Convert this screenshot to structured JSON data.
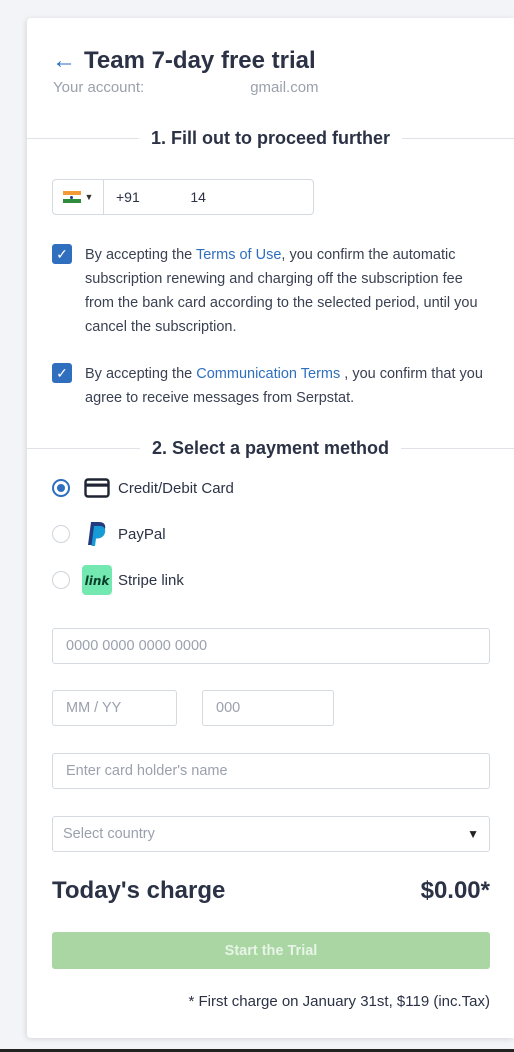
{
  "header": {
    "back_icon": "arrow-left-icon",
    "title": "Team 7-day free trial",
    "account_prefix": "Your account:",
    "account_suffix": "gmail.com"
  },
  "section1": {
    "title": "1. Fill out to proceed further"
  },
  "phone": {
    "country_flag": "india-flag-icon",
    "value": "+91             14"
  },
  "terms": {
    "before": "By accepting the ",
    "link": "Terms of Use",
    "after": ", you confirm the automatic subscription renewing and charging off the subscription fee from the bank card according to the selected period, until you cancel the subscription.",
    "checked": true
  },
  "communication": {
    "before": "By accepting the ",
    "link": "Communication Terms",
    "after": " , you confirm that you agree to receive messages from Serpstat.",
    "checked": true
  },
  "section2": {
    "title": "2. Select a payment method"
  },
  "payment_methods": [
    {
      "label": "Credit/Debit Card",
      "icon": "credit-card-icon",
      "selected": true
    },
    {
      "label": "PayPal",
      "icon": "paypal-icon",
      "selected": false
    },
    {
      "label": "Stripe link",
      "icon": "stripe-link-icon",
      "selected": false
    }
  ],
  "card_form": {
    "card_number_placeholder": "0000 0000 0000 0000",
    "expiry_placeholder": "MM / YY",
    "cvc_placeholder": "000",
    "holder_placeholder": "Enter card holder's name",
    "country_placeholder": "Select country"
  },
  "charge": {
    "label": "Today's charge",
    "value": "$0.00*"
  },
  "cta": {
    "label": "Start the Trial"
  },
  "footnote": "* First charge on January 31st, $119 (inc.Tax)",
  "colors": {
    "accent": "#2f6fbe",
    "cta_disabled": "#a9d6a3",
    "text": "#2b3245",
    "muted": "#9aa1ad"
  }
}
